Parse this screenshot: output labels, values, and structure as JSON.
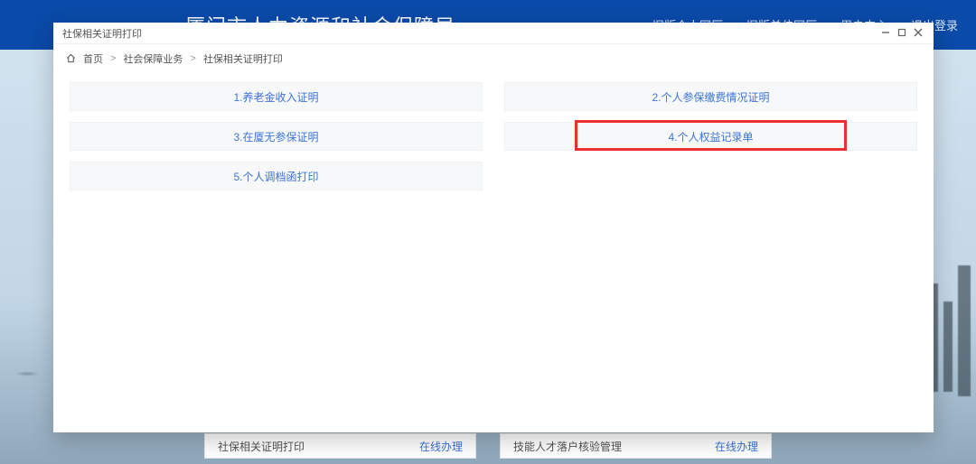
{
  "bg_header": {
    "title": "厦门市人力资源和社会保障局",
    "nav": [
      "旧版个人网厅",
      "旧版单位网厅",
      "用户中心",
      "退出登录"
    ]
  },
  "bg_cards": [
    {
      "title": "社保相关证明打印",
      "action": "在线办理"
    },
    {
      "title": "技能人才落户核验管理",
      "action": "在线办理"
    }
  ],
  "modal": {
    "title": "社保相关证明打印",
    "breadcrumb": {
      "home": "首页",
      "items": [
        "社会保障业务",
        "社保相关证明打印"
      ]
    },
    "options": [
      "1.养老金收入证明",
      "2.个人参保缴费情况证明",
      "3.在厦无参保证明",
      "4.个人权益记录单",
      "5.个人调档函打印"
    ],
    "highlight_index": 3
  }
}
